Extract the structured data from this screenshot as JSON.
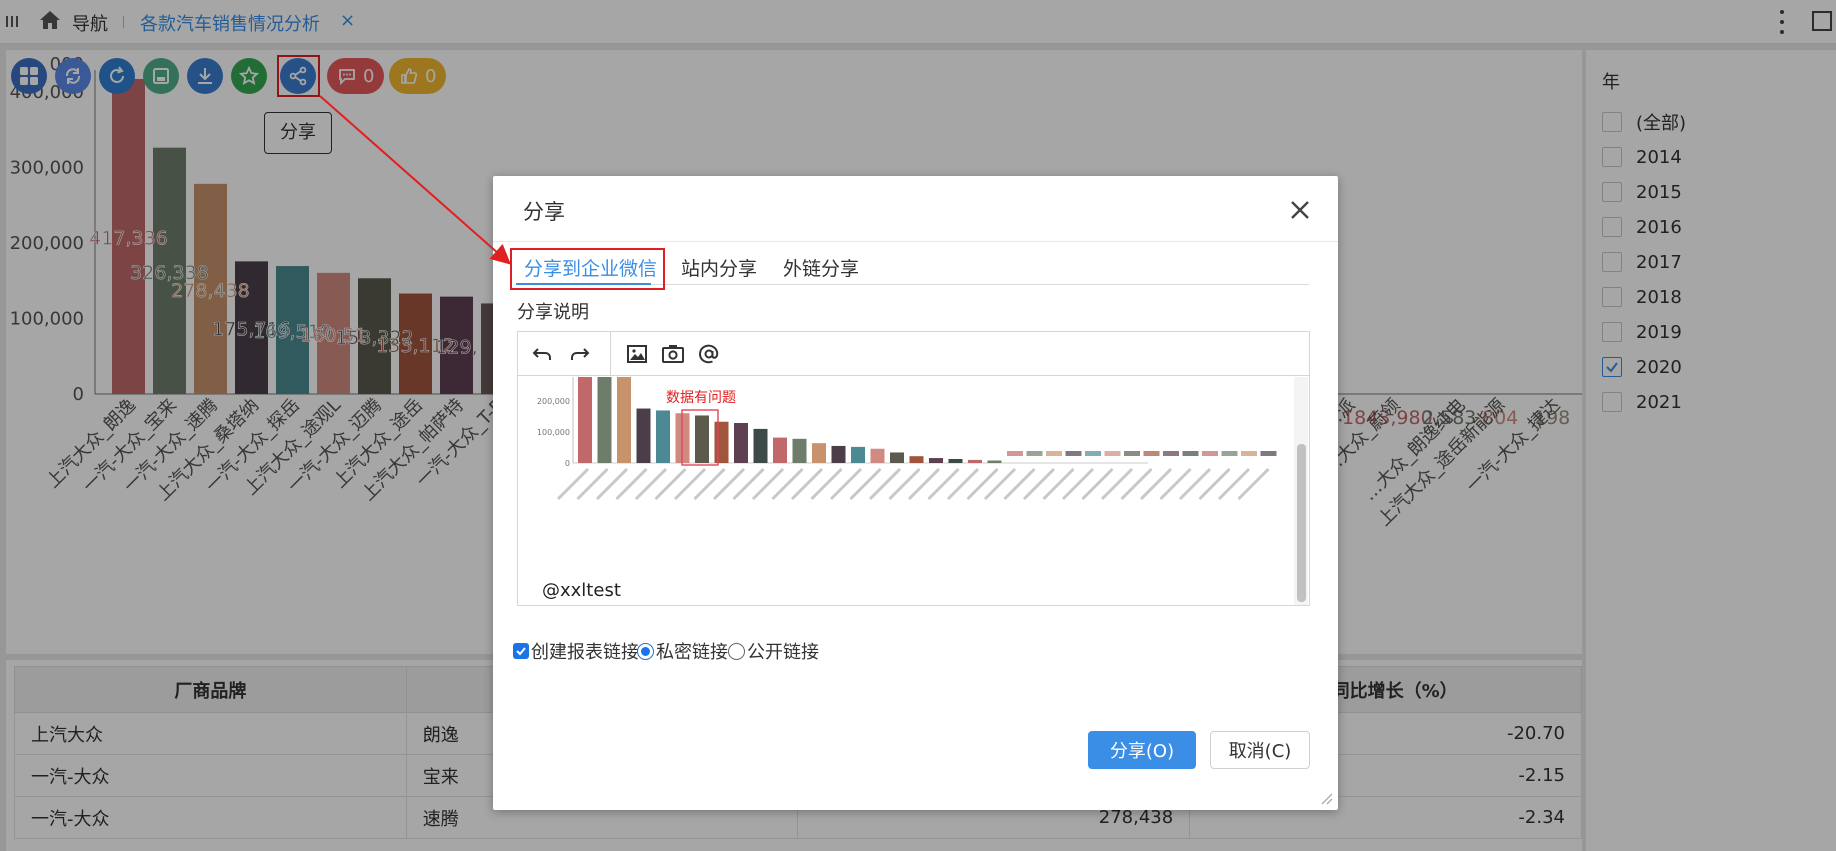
{
  "topbar": {
    "nav_label": "导航",
    "tab_label": "各款汽车销售情况分析",
    "tab_close": "×"
  },
  "toolbar": {
    "comment_count": "0",
    "like_count": "0",
    "share_tooltip": "分享",
    "colors": {
      "grid": "#3b6fc4",
      "sync": "#5a8be8",
      "refresh": "#2f7fd3",
      "save": "#4fae8a",
      "download": "#3b7dd0",
      "star": "#35a852",
      "share": "#3b7dd0",
      "comment": "#e45a5a",
      "like": "#f2b731"
    }
  },
  "chart_data": {
    "type": "bar",
    "title": "",
    "xlabel": "",
    "ylabel": "",
    "ylim": [
      0,
      420000
    ],
    "yticks": [
      "0",
      "100,000",
      "200,000",
      "300,000",
      "400,000"
    ],
    "y_top_partial_label": "000",
    "categories": [
      "上汽大众_朗逸",
      "一汽-大众_宝来",
      "一汽-大众_速腾",
      "上汽大众_桑塔纳",
      "一汽-大众_探岳",
      "上汽大众_途观L",
      "一汽-大众_迈腾",
      "上汽大众_途岳",
      "上汽大众_帕萨特",
      "一汽-大众_T-R"
    ],
    "values": [
      417336,
      326338,
      278438,
      175716,
      169510,
      160510,
      153322,
      133112,
      129000,
      120000
    ],
    "value_labels": [
      "417,336",
      "326,338",
      "278,438",
      "175,716",
      "169,510",
      "160,51",
      "153,322",
      "133,112",
      "129,",
      ""
    ],
    "colors": [
      "#c1696a",
      "#6e7d6a",
      "#c7936c",
      "#4a3f49",
      "#4c8a93",
      "#d08a80",
      "#5b5a4d",
      "#a2553d",
      "#5d4052",
      "#6b5a5a"
    ],
    "right_partial_value_labels": [
      "1843,980",
      "2,583",
      "804",
      "198"
    ],
    "right_partial_categories": [
      "…派",
      "…大众_蔚领",
      "…大众_朗逸纯电",
      "上汽大众_途岳新能源",
      "一汽-大众_捷达"
    ]
  },
  "filter": {
    "title": "年",
    "items": [
      {
        "label": "(全部)",
        "checked": false
      },
      {
        "label": "2014",
        "checked": false
      },
      {
        "label": "2015",
        "checked": false
      },
      {
        "label": "2016",
        "checked": false
      },
      {
        "label": "2017",
        "checked": false
      },
      {
        "label": "2018",
        "checked": false
      },
      {
        "label": "2019",
        "checked": false
      },
      {
        "label": "2020",
        "checked": true
      },
      {
        "label": "2021",
        "checked": false
      }
    ]
  },
  "table": {
    "headers": [
      "厂商品牌",
      "",
      "",
      "量同比增长（%）"
    ],
    "rows": [
      [
        "上汽大众",
        "朗逸",
        "",
        "-20.70"
      ],
      [
        "一汽-大众",
        "宝来",
        "",
        "-2.15"
      ],
      [
        "一汽-大众",
        "速腾",
        "278,438",
        "-2.34"
      ]
    ]
  },
  "dialog": {
    "title": "分享",
    "tabs": [
      "分享到企业微信",
      "站内分享",
      "外链分享"
    ],
    "active_tab": 0,
    "description_label": "分享说明",
    "editor_annotation": "数据有问题",
    "editor_mention": "@xxltest",
    "options": {
      "create_link": "创建报表链接",
      "private_link": "私密链接",
      "public_link": "公开链接"
    },
    "ok_label": "分享(O)",
    "cancel_label": "取消(C)"
  },
  "thumbnail": {
    "yticks": [
      "0",
      "100,000",
      "200,000"
    ],
    "bar_colors": [
      "#c1696a",
      "#6e7d6a",
      "#c7936c",
      "#4a3f49",
      "#4c8a93",
      "#d08a80",
      "#5b5a4d",
      "#a2553d",
      "#5d4052",
      "#3e4a48",
      "#c1696a",
      "#6e7d6a",
      "#c7936c",
      "#4a3f49",
      "#4c8a93",
      "#d08a80",
      "#5b5a4d",
      "#a2553d",
      "#5d4052",
      "#3e4a48",
      "#c1696a",
      "#6e7d6a"
    ],
    "bar_values": [
      417336,
      326338,
      278438,
      175716,
      169510,
      160510,
      153322,
      133112,
      129000,
      110000,
      82000,
      78000,
      64000,
      55000,
      52000,
      46000,
      34000,
      22000,
      16000,
      13000,
      10000,
      8000
    ]
  }
}
